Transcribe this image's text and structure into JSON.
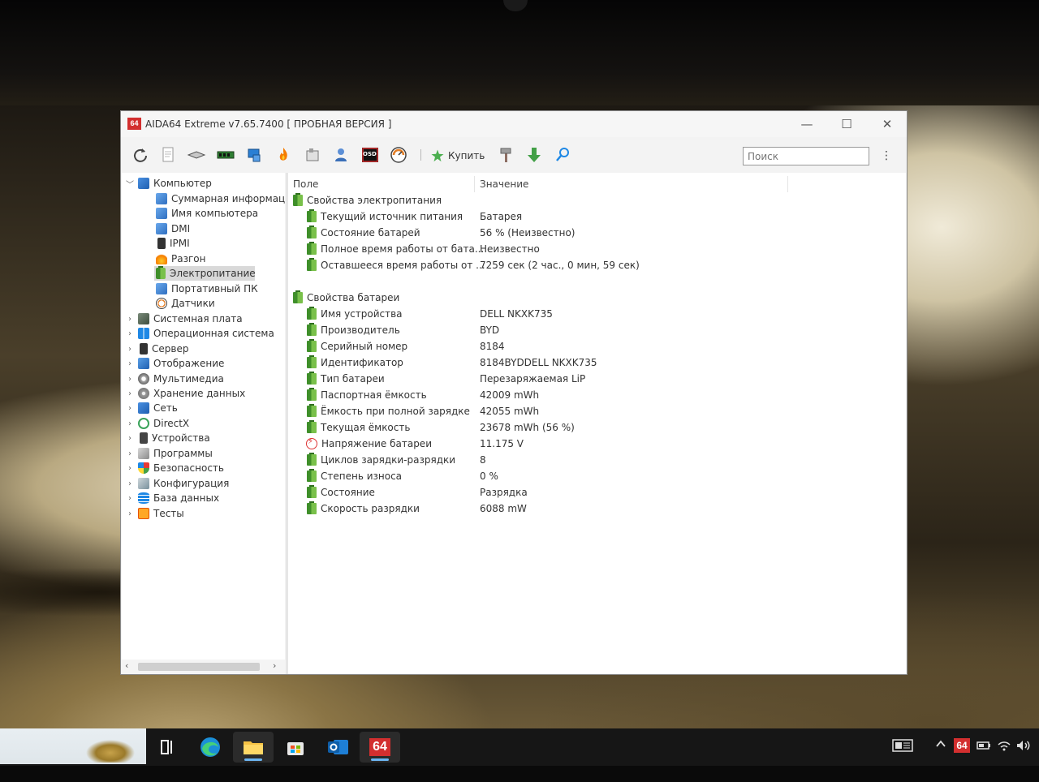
{
  "window": {
    "title": "AIDA64 Extreme v7.65.7400  [ ПРОБНАЯ ВЕРСИЯ ]",
    "logo_text": "64",
    "controls": {
      "minimize": "—",
      "maximize": "☐",
      "close": "✕"
    }
  },
  "toolbar": {
    "buy_label": "Купить",
    "search_placeholder": "Поиск",
    "osd_label": "OSD",
    "more_glyph": "⋮"
  },
  "tree": {
    "root": "Компьютер",
    "children": [
      "Суммарная информация",
      "Имя компьютера",
      "DMI",
      "IPMI",
      "Разгон",
      "Электропитание",
      "Портативный ПК",
      "Датчики"
    ],
    "selected": "Электропитание",
    "categories": [
      "Системная плата",
      "Операционная система",
      "Сервер",
      "Отображение",
      "Мультимедиа",
      "Хранение данных",
      "Сеть",
      "DirectX",
      "Устройства",
      "Программы",
      "Безопасность",
      "Конфигурация",
      "База данных",
      "Тесты"
    ]
  },
  "list": {
    "col_field": "Поле",
    "col_value": "Значение",
    "groups": [
      {
        "title": "Свойства электропитания",
        "rows": [
          {
            "field": "Текущий источник питания",
            "value": "Батарея"
          },
          {
            "field": "Состояние батарей",
            "value": "56 % (Неизвестно)"
          },
          {
            "field": "Полное время работы от бата...",
            "value": "Неизвестно"
          },
          {
            "field": "Оставшееся время работы от ...",
            "value": "7259 сек (2 час., 0 мин, 59 сек)"
          }
        ]
      },
      {
        "title": "Свойства батареи",
        "rows": [
          {
            "field": "Имя устройства",
            "value": "DELL NKXK735"
          },
          {
            "field": "Производитель",
            "value": "BYD"
          },
          {
            "field": "Серийный номер",
            "value": "8184"
          },
          {
            "field": "Идентификатор",
            "value": "8184BYDDELL NKXK735"
          },
          {
            "field": "Тип батареи",
            "value": "Перезаряжаемая LiP"
          },
          {
            "field": "Паспортная ёмкость",
            "value": "42009 mWh"
          },
          {
            "field": "Ёмкость при полной зарядке",
            "value": "42055 mWh"
          },
          {
            "field": "Текущая ёмкость",
            "value": "23678 mWh  (56 %)"
          },
          {
            "field": "Напряжение батареи",
            "value": "11.175 V"
          },
          {
            "field": "Циклов зарядки-разрядки",
            "value": "8"
          },
          {
            "field": "Степень износа",
            "value": "0 %"
          },
          {
            "field": "Состояние",
            "value": "Разрядка"
          },
          {
            "field": "Скорость разрядки",
            "value": "6088 mW"
          }
        ]
      }
    ]
  },
  "taskbar": {
    "aida_label": "64",
    "tray_aida_label": "64"
  },
  "colors": {
    "aida_red": "#d32f2f",
    "battery_green": "#4caf50",
    "selection_gray": "#d9d9d9",
    "taskbar_accent": "#6cb4f0"
  }
}
